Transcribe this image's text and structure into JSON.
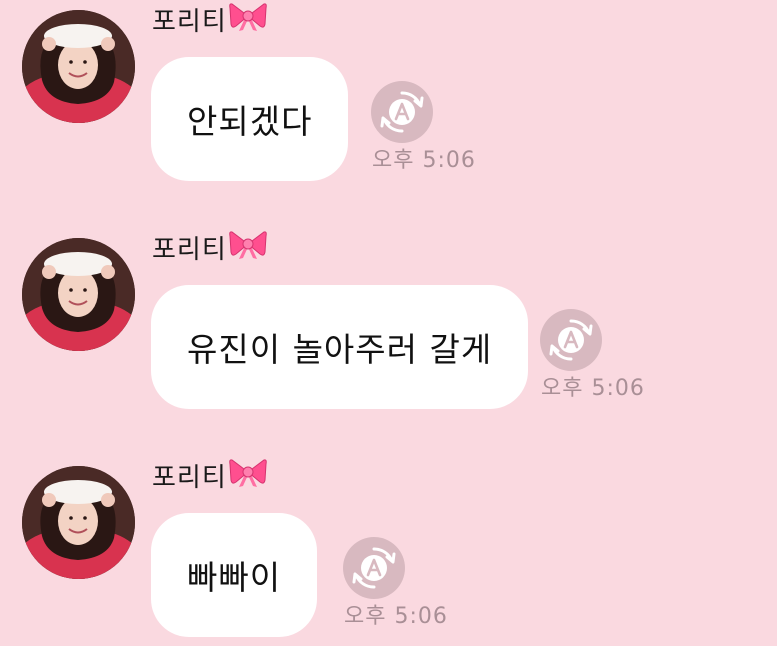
{
  "colors": {
    "background": "#fad9e0",
    "bubble": "#ffffff",
    "translate_button": "#d8b9c0",
    "timestamp": "#a98f96",
    "bow": "#ff4f8f"
  },
  "messages": [
    {
      "sender": "포리티",
      "sender_emoji": "bow-emoji",
      "text": "안되겠다",
      "time": "오후 5:06",
      "translate_icon": "translate-a-icon"
    },
    {
      "sender": "포리티",
      "sender_emoji": "bow-emoji",
      "text": "유진이 놀아주러 갈게",
      "time": "오후 5:06",
      "translate_icon": "translate-a-icon"
    },
    {
      "sender": "포리티",
      "sender_emoji": "bow-emoji",
      "text": "빠빠이",
      "time": "오후 5:06",
      "translate_icon": "translate-a-icon"
    }
  ]
}
